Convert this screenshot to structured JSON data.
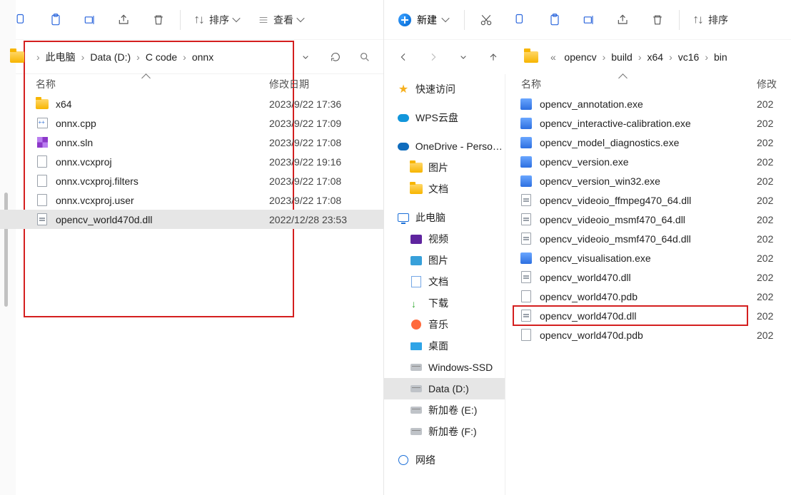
{
  "left": {
    "toolbar": {
      "sort_label": "排序",
      "view_label": "查看"
    },
    "crumbs": [
      "此电脑",
      "Data (D:)",
      "C code",
      "onnx"
    ],
    "columns": {
      "name": "名称",
      "date": "修改日期"
    },
    "files": [
      {
        "icon": "folder",
        "name": "x64",
        "date": "2023/9/22 17:36"
      },
      {
        "icon": "cpp",
        "name": "onnx.cpp",
        "date": "2023/9/22 17:09"
      },
      {
        "icon": "sln",
        "name": "onnx.sln",
        "date": "2023/9/22 17:08"
      },
      {
        "icon": "file",
        "name": "onnx.vcxproj",
        "date": "2023/9/22 19:16"
      },
      {
        "icon": "filters",
        "name": "onnx.vcxproj.filters",
        "date": "2023/9/22 17:08"
      },
      {
        "icon": "file",
        "name": "onnx.vcxproj.user",
        "date": "2023/9/22 17:08"
      },
      {
        "icon": "dll",
        "name": "opencv_world470d.dll",
        "date": "2022/12/28 23:53",
        "selected": true
      }
    ]
  },
  "right": {
    "toolbar": {
      "new_label": "新建",
      "sort_label": "排序"
    },
    "crumbs_prefix": "«",
    "crumbs": [
      "opencv",
      "build",
      "x64",
      "vc16",
      "bin"
    ],
    "columns": {
      "name": "名称",
      "date": "修改"
    },
    "partial_year": "202",
    "nav": [
      {
        "icon": "star",
        "label": "快速访问"
      },
      {
        "icon": "cloud",
        "label": "WPS云盘"
      },
      {
        "icon": "onedrive",
        "label": "OneDrive - Personal"
      },
      {
        "icon": "folder",
        "label": "图片",
        "indent": true
      },
      {
        "icon": "folder",
        "label": "文档",
        "indent": true
      },
      {
        "icon": "monitor",
        "label": "此电脑"
      },
      {
        "icon": "video",
        "label": "视频",
        "indent": true
      },
      {
        "icon": "pic",
        "label": "图片",
        "indent": true
      },
      {
        "icon": "doc",
        "label": "文档",
        "indent": true
      },
      {
        "icon": "down",
        "label": "下载",
        "indent": true
      },
      {
        "icon": "music",
        "label": "音乐",
        "indent": true
      },
      {
        "icon": "desk",
        "label": "桌面",
        "indent": true
      },
      {
        "icon": "drive",
        "label": "Windows-SSD",
        "indent": true
      },
      {
        "icon": "drive",
        "label": "Data (D:)",
        "indent": true,
        "selected": true
      },
      {
        "icon": "drive",
        "label": "新加卷 (E:)",
        "indent": true
      },
      {
        "icon": "drive",
        "label": "新加卷 (F:)",
        "indent": true
      },
      {
        "icon": "net",
        "label": "网络"
      }
    ],
    "files": [
      {
        "icon": "exe",
        "name": "opencv_annotation.exe"
      },
      {
        "icon": "exe",
        "name": "opencv_interactive-calibration.exe"
      },
      {
        "icon": "exe",
        "name": "opencv_model_diagnostics.exe"
      },
      {
        "icon": "exe",
        "name": "opencv_version.exe"
      },
      {
        "icon": "exe",
        "name": "opencv_version_win32.exe"
      },
      {
        "icon": "dll",
        "name": "opencv_videoio_ffmpeg470_64.dll"
      },
      {
        "icon": "dll",
        "name": "opencv_videoio_msmf470_64.dll"
      },
      {
        "icon": "dll",
        "name": "opencv_videoio_msmf470_64d.dll"
      },
      {
        "icon": "exe",
        "name": "opencv_visualisation.exe"
      },
      {
        "icon": "dll",
        "name": "opencv_world470.dll"
      },
      {
        "icon": "pdb",
        "name": "opencv_world470.pdb"
      },
      {
        "icon": "dll",
        "name": "opencv_world470d.dll",
        "highlight": true
      },
      {
        "icon": "pdb",
        "name": "opencv_world470d.pdb"
      }
    ]
  }
}
